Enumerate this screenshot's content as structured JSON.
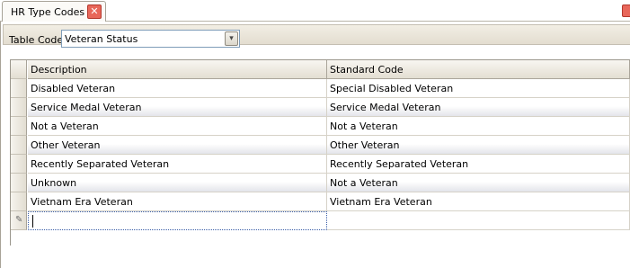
{
  "tab": {
    "title": "HR Type Codes",
    "close_glyph": "✕"
  },
  "filter": {
    "label": "Table Code",
    "value": "Veteran Status",
    "dropdown_glyph": "▾"
  },
  "grid": {
    "columns": [
      "Description",
      "Standard Code"
    ],
    "rows": [
      [
        "Disabled Veteran",
        "Special Disabled Veteran"
      ],
      [
        "Service Medal Veteran",
        "Service Medal Veteran"
      ],
      [
        "Not a Veteran",
        "Not a Veteran"
      ],
      [
        "Other Veteran",
        "Other Veteran"
      ],
      [
        "Recently Separated Veteran",
        "Recently Separated Veteran"
      ],
      [
        "Unknown",
        "Not a Veteran"
      ],
      [
        "Vietnam Era Veteran",
        "Vietnam Era Veteran"
      ]
    ],
    "new_row_glyph": "✎"
  },
  "colors": {
    "accent_close": "#e8675a",
    "alt_row": "#e3e4ea",
    "focus_border": "#3a5ea8"
  }
}
